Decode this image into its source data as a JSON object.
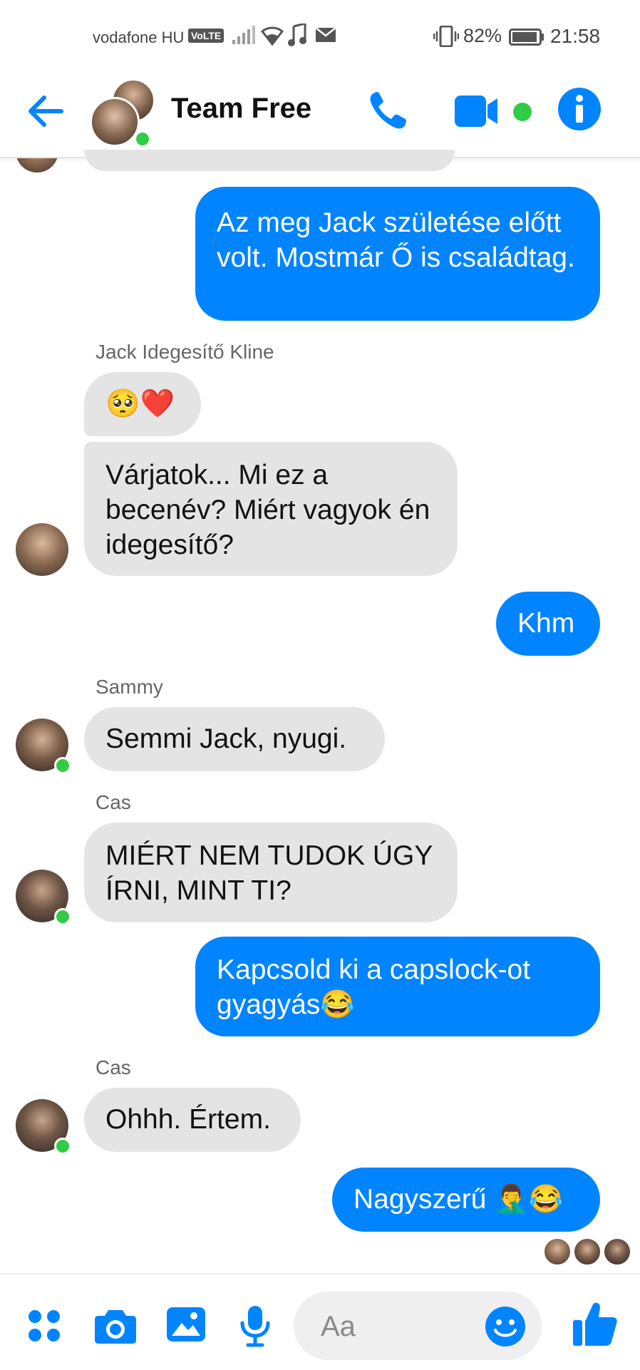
{
  "status_bar": {
    "carrier": "vodafone HU",
    "volte": "VoLTE",
    "battery": "82%",
    "time": "21:58"
  },
  "header": {
    "title": "Team Free"
  },
  "messages": [
    {
      "side": "out",
      "text": "Az meg Jack születése előtt volt. Mostmár Ő is családtag."
    },
    {
      "side": "in",
      "sender": "Jack Idegesítő Kline",
      "text": "🥺❤️"
    },
    {
      "side": "in",
      "text": "Várjatok... Mi ez a becenév? Miért vagyok én idegesítő?"
    },
    {
      "side": "out",
      "text": "Khm"
    },
    {
      "side": "in",
      "sender": "Sammy",
      "text": "Semmi Jack, nyugi."
    },
    {
      "side": "in",
      "sender": "Cas",
      "text": "MIÉRT NEM TUDOK ÚGY ÍRNI, MINT TI?"
    },
    {
      "side": "out",
      "text": "Kapcsold ki a capslock-ot gyagyás😂"
    },
    {
      "side": "in",
      "sender": "Cas",
      "text": "Ohhh. Értem."
    },
    {
      "side": "out",
      "text": "Nagyszerű 🤦‍♂️😂"
    }
  ],
  "composer": {
    "placeholder": "Aa"
  },
  "colors": {
    "accent": "#0084ff",
    "incoming_bubble": "#e4e4e4",
    "online": "#31cc46"
  },
  "icons": {
    "header": [
      "back-arrow-icon",
      "phone-icon",
      "video-camera-icon",
      "info-icon"
    ],
    "footer": [
      "apps-grid-icon",
      "camera-icon",
      "gallery-icon",
      "microphone-icon",
      "emoji-icon",
      "thumbs-up-icon"
    ]
  }
}
